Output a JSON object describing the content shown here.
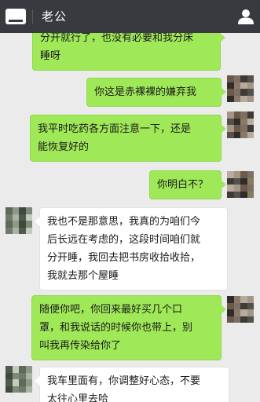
{
  "header": {
    "title": "老公",
    "keyboard_icon": "keyboard-icon",
    "profile_icon": "user-profile-icon"
  },
  "messages": [
    {
      "side": "right",
      "lines": [
        "分开就行了，也没有必要和我分床",
        "睡呀"
      ]
    },
    {
      "side": "right",
      "lines": [
        "你这是赤裸裸的嫌弃我"
      ]
    },
    {
      "side": "right",
      "lines": [
        "我平时吃药各方面注意一下，还是",
        "能恢复好的"
      ]
    },
    {
      "side": "right",
      "lines": [
        "你明白不？"
      ]
    },
    {
      "side": "left",
      "lines": [
        "我也不是那意思，我真的为咱们今",
        "后长远在考虑的，这段时间咱们就",
        "分开睡，我回去把书房收拾收拾，",
        "我就去那个屋睡"
      ]
    },
    {
      "side": "right",
      "lines": [
        "随便你吧，你回来最好买几个口",
        "罩，和我说话的时候你也带上，别",
        "叫我再传染给你了"
      ]
    },
    {
      "side": "left",
      "lines": [
        "我车里面有，你调整好心态，不要",
        "太往心里去哈"
      ]
    }
  ],
  "colors": {
    "topbar": "#393a3f",
    "background": "#ebebeb",
    "sent_bubble": "#9fe858",
    "received_bubble": "#ffffff"
  }
}
